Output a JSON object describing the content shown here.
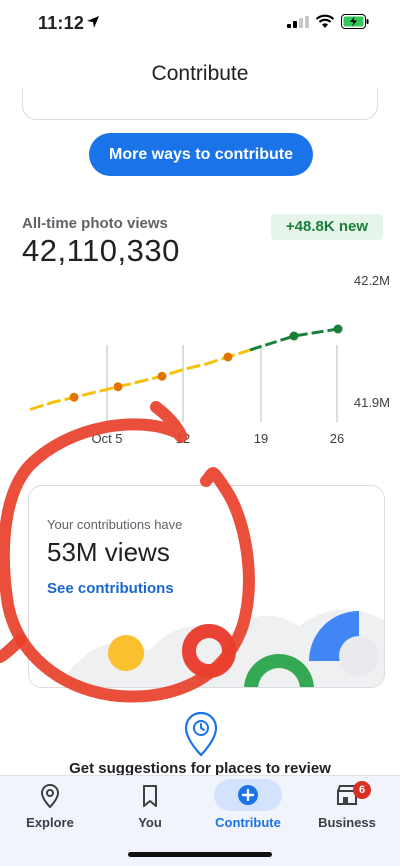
{
  "status_bar": {
    "time": "11:12"
  },
  "header": {
    "title": "Contribute"
  },
  "more_ways_button": {
    "label": "More ways to contribute"
  },
  "photo_views": {
    "label": "All-time photo views",
    "value": "42,110,330",
    "new_badge": "+48.8K new"
  },
  "chart_data": {
    "type": "line",
    "y_ticks": [
      "42.2M",
      "41.9M"
    ],
    "x_ticks": [
      "Oct 5",
      "12",
      "19",
      "26"
    ],
    "series": [
      {
        "values": [
          41.88,
          41.9,
          41.915,
          41.93,
          41.945,
          41.96,
          41.975,
          41.995,
          42.01,
          42.03,
          42.05,
          42.07,
          42.09,
          42.1,
          42.11
        ]
      }
    ],
    "colors": {
      "older": "#f4c20d",
      "recent": "#188038",
      "marker": "#e37400",
      "gridline": "#dadce0"
    },
    "grid": false
  },
  "contributions_card": {
    "caption": "Your contributions have",
    "value": "53M views",
    "link": "See contributions"
  },
  "suggestions": {
    "text": "Get suggestions for places to review"
  },
  "bottom_nav": {
    "items": [
      {
        "label": "Explore",
        "icon": "location-pin-icon"
      },
      {
        "label": "You",
        "icon": "bookmark-icon"
      },
      {
        "label": "Contribute",
        "icon": "add-circle-icon",
        "active": true
      },
      {
        "label": "Business",
        "icon": "storefront-icon",
        "badge": "6"
      }
    ]
  },
  "colors": {
    "accent": "#1a73e8",
    "annotation": "#e8402a"
  }
}
